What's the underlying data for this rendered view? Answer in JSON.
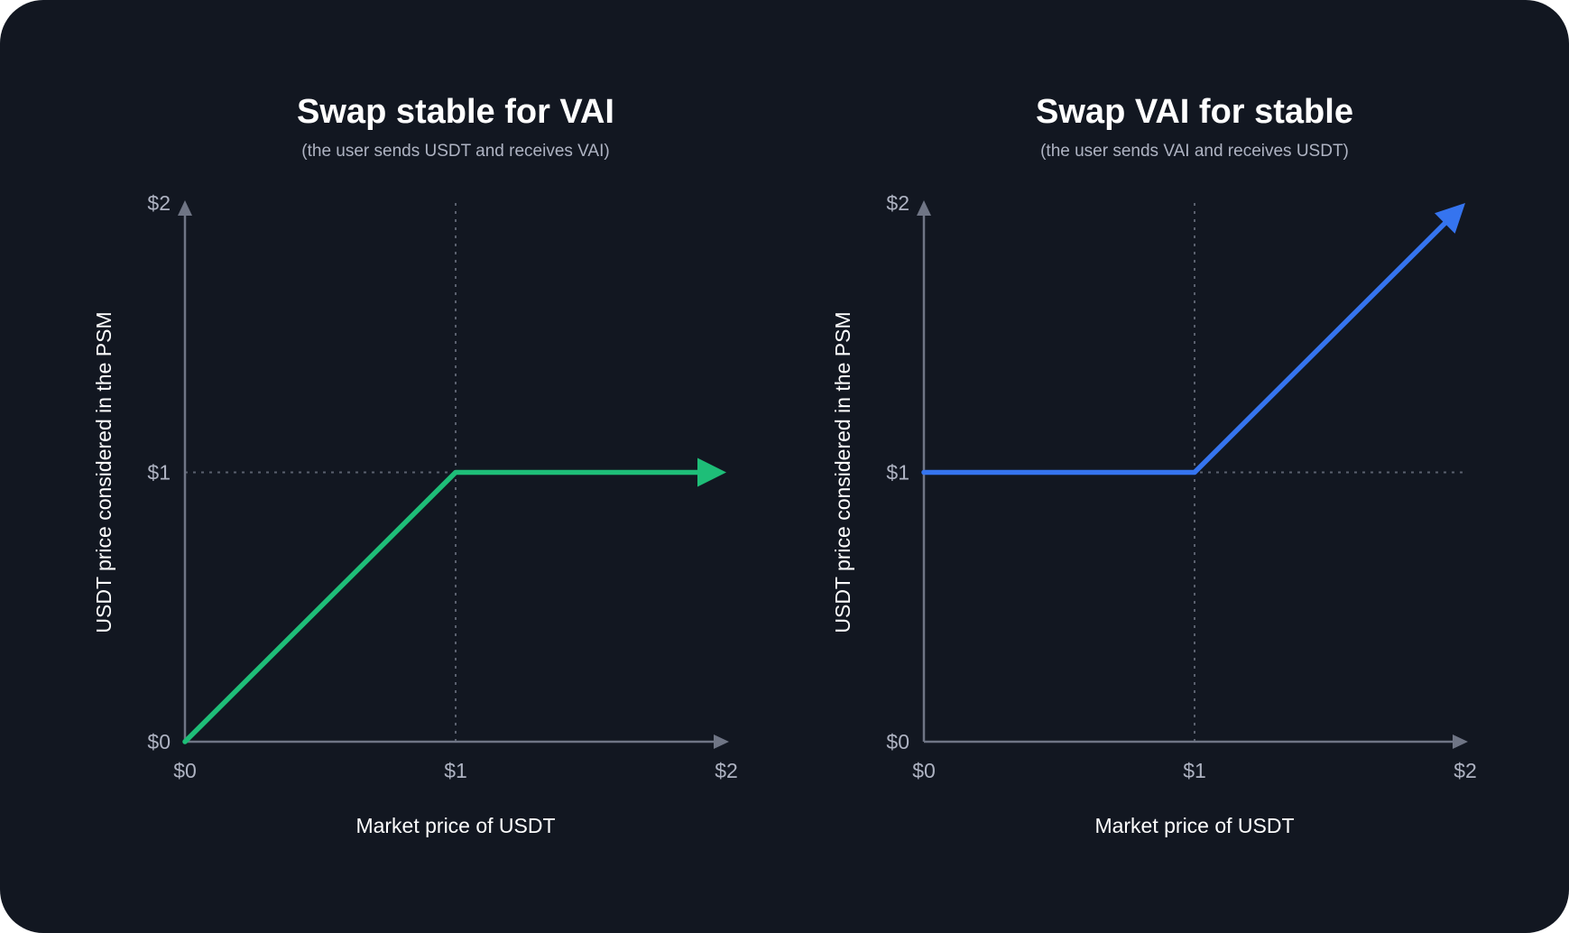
{
  "chart_data": [
    {
      "type": "line",
      "title": "Swap stable for VAI",
      "subtitle": "(the user sends USDT and receives VAI)",
      "xlabel": "Market price of USDT",
      "ylabel": "USDT price considered in the PSM",
      "xlim": [
        0,
        2
      ],
      "ylim": [
        0,
        2
      ],
      "x_ticks": [
        "$0",
        "$1",
        "$2"
      ],
      "y_ticks": [
        "$0",
        "$1",
        "$2"
      ],
      "reference_lines": {
        "x": 1,
        "y": 1,
        "style": "dotted"
      },
      "series": [
        {
          "color": "#1ebe78",
          "x": [
            0,
            1,
            2
          ],
          "y": [
            0,
            1,
            1
          ],
          "arrow_end": true
        }
      ]
    },
    {
      "type": "line",
      "title": "Swap VAI for stable",
      "subtitle": "(the user sends VAI and receives USDT)",
      "xlabel": "Market price of USDT",
      "ylabel": "USDT price considered in the PSM",
      "xlim": [
        0,
        2
      ],
      "ylim": [
        0,
        2
      ],
      "x_ticks": [
        "$0",
        "$1",
        "$2"
      ],
      "y_ticks": [
        "$0",
        "$1",
        "$2"
      ],
      "reference_lines": {
        "x": 1,
        "y": 1,
        "style": "dotted"
      },
      "series": [
        {
          "color": "#3574ef",
          "x": [
            0,
            1,
            2
          ],
          "y": [
            1,
            1,
            2
          ],
          "arrow_end": true
        }
      ]
    }
  ],
  "colors": {
    "background": "#121721",
    "axis": "#6f7585",
    "grid": "#5a606e",
    "tick_text": "#aeb3c2",
    "title_text": "#ffffff"
  }
}
